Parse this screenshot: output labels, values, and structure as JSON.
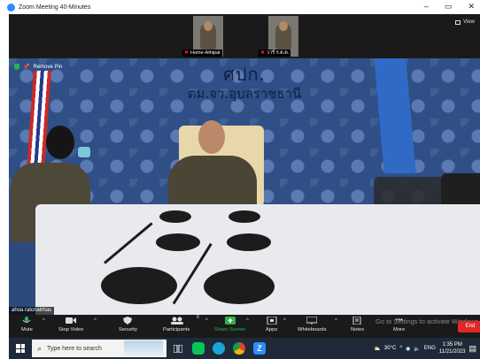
{
  "window": {
    "title": "Zoom Meeting 40-Minutes",
    "controls": [
      "–",
      "▭",
      "✕"
    ]
  },
  "view_button": {
    "label": "View"
  },
  "thumbnails": [
    {
      "name": "Home-Athipat",
      "muted": true
    },
    {
      "name": "วารี ร.ต.ต.",
      "muted": true
    }
  ],
  "main_video": {
    "remove_pin_label": "Remove Pin",
    "banner_line1": "ศปก.",
    "banner_line2": "ตม.จว.อุบลราชธานี",
    "speaker_name": "ahoa ratcnatrhas"
  },
  "controls": {
    "mute": "Mute",
    "stop_video": "Stop Video",
    "security": "Security",
    "participants": "Participants",
    "participants_count": "8",
    "share_screen": "Share Screen",
    "apps": "Apps",
    "whiteboards": "Whiteboards",
    "notes": "Notes",
    "more": "More",
    "end": "End",
    "watermark": "Go to Settings to activate Windows."
  },
  "taskbar": {
    "search_placeholder": "Type here to search",
    "temperature": "30°C",
    "language": "ENG",
    "time": "1:35 PM",
    "date": "11/21/2023"
  },
  "colors": {
    "zoom_blue": "#2d8cff",
    "end_red": "#e02828",
    "share_green": "#2cb24a",
    "taskbar": "#1e2a38"
  }
}
